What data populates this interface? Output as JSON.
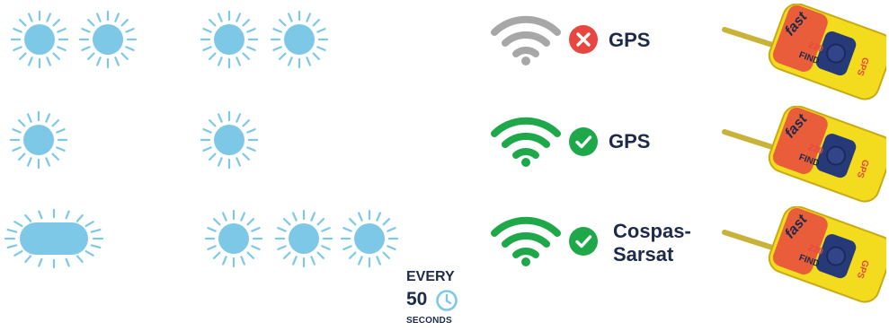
{
  "colors": {
    "lamp_fill": "#7cc8e6",
    "rays": "#7cc8e6",
    "wifi_off": "#a7a7a7",
    "wifi_on": "#1ea84a",
    "fail": "#e8473f",
    "ok": "#1ea84a",
    "text": "#1d2a4a",
    "beacon_body": "#f3dc1e",
    "beacon_antenna": "#c8b23a"
  },
  "rows": [
    {
      "left_pattern": "two-flashes",
      "right_pattern": "two-flashes",
      "signal": "wifi-off-icon",
      "status": "cross-icon",
      "label_lines": [
        "GPS"
      ]
    },
    {
      "left_pattern": "single-flash",
      "right_pattern": "single-flash",
      "signal": "wifi-on-icon",
      "status": "check-icon",
      "label_lines": [
        "GPS"
      ]
    },
    {
      "left_pattern": "long-flash",
      "right_pattern": "three-flashes",
      "signal": "wifi-on-icon",
      "status": "check-icon",
      "label_lines": [
        "Cospas-",
        "Sarsat"
      ]
    }
  ],
  "timer": {
    "every": "EVERY",
    "interval": "50",
    "unit": "SECONDS",
    "icon": "clock-icon"
  },
  "beacon": {
    "brand_top": "fast",
    "brand_bottom": "FIND",
    "model": "220",
    "mode": "GPS"
  }
}
